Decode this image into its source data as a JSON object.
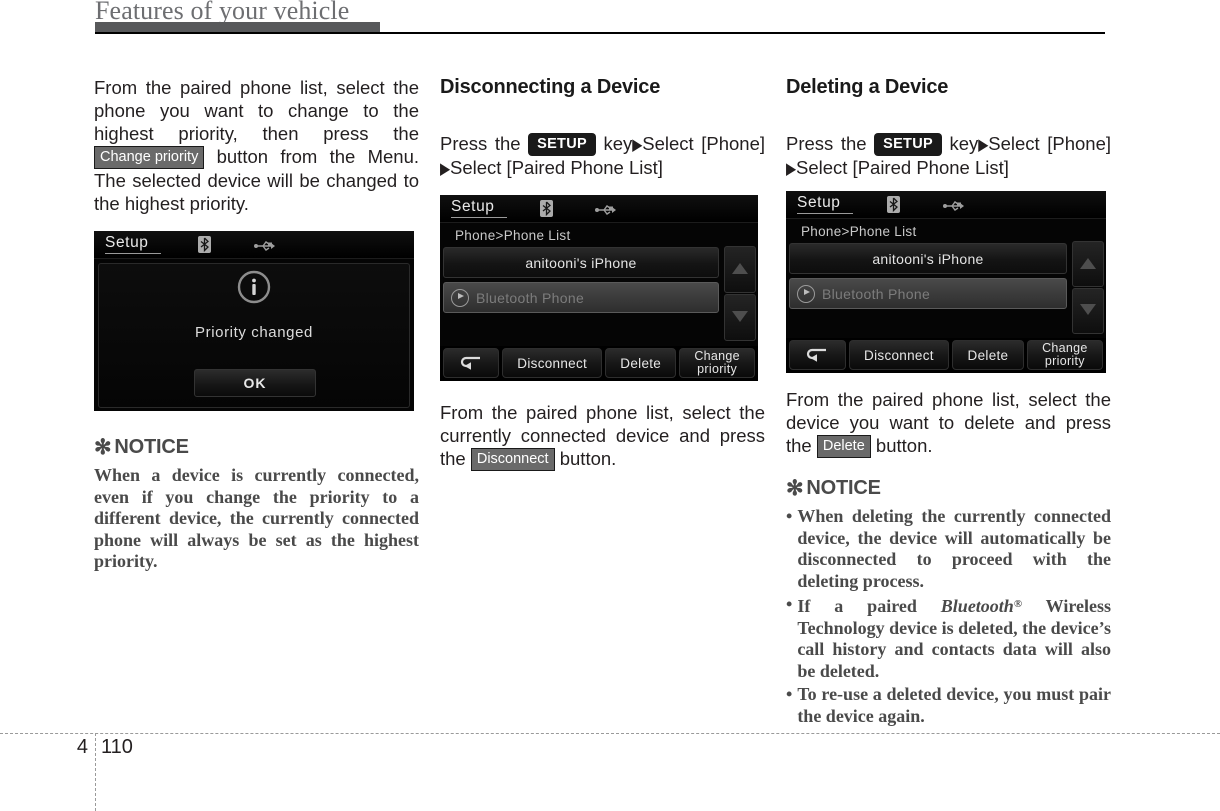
{
  "header": {
    "title": "Features of your vehicle"
  },
  "footer": {
    "chapter": "4",
    "page": "110"
  },
  "columns": {
    "col1": {
      "intro": {
        "part1": "From the paired phone list, select the phone you want to change to the highest priority, then press the",
        "badge": "Change priority",
        "part2": "button from the Menu. The selected device will be changed to the highest priority."
      },
      "screenshot": {
        "name": "setup-priority-changed-dialog",
        "title": "Setup",
        "bluetooth_icon": "bluetooth-icon",
        "usb_icon": "usb-icon",
        "info_icon": "info-icon",
        "message": "Priority changed",
        "ok_label": "OK"
      },
      "notice": {
        "star": "✻",
        "heading": "NOTICE",
        "body": "When a device is currently connected, even if you change the priority to a different device, the currently connected phone will always be set as the highest priority."
      }
    },
    "col2": {
      "heading": "Disconnecting a Device",
      "steps": {
        "press_the": "Press the",
        "setup_key": "SETUP",
        "key_word": "key",
        "arrow": "▶",
        "select1": "Select [Phone]",
        "select2": "Select [Paired Phone List]"
      },
      "screenshot": {
        "name": "setup-phone-list-screen",
        "title": "Setup",
        "bluetooth_icon": "bluetooth-icon",
        "usb_icon": "usb-icon",
        "breadcrumb": "Phone>Phone List",
        "rows": [
          {
            "label": "anitooni's iPhone",
            "has_play_icon": false,
            "selected": false
          },
          {
            "label": "Bluetooth Phone",
            "has_play_icon": true,
            "selected": true
          }
        ],
        "scroll_up_icon": "arrow-up-icon",
        "scroll_down_icon": "arrow-down-icon",
        "toolbar": [
          {
            "label": "",
            "icon": "back-arrow-icon"
          },
          {
            "label": "Disconnect",
            "icon": ""
          },
          {
            "label": "Delete",
            "icon": ""
          },
          {
            "label": "Change priority",
            "icon": ""
          }
        ]
      },
      "caption": {
        "part1": "From the paired phone list, select the currently connected device and press the",
        "badge": "Disconnect",
        "part2": "button."
      }
    },
    "col3": {
      "heading": "Deleting a Device",
      "steps": {
        "press_the": "Press the",
        "setup_key": "SETUP",
        "key_word": "key",
        "arrow": "▶",
        "select1": "Select [Phone]",
        "select2": "Select [Paired Phone List]"
      },
      "screenshot": {
        "name": "setup-phone-list-screen",
        "title": "Setup",
        "bluetooth_icon": "bluetooth-icon",
        "usb_icon": "usb-icon",
        "breadcrumb": "Phone>Phone List",
        "rows": [
          {
            "label": "anitooni's iPhone",
            "has_play_icon": false,
            "selected": false
          },
          {
            "label": "Bluetooth Phone",
            "has_play_icon": true,
            "selected": true
          }
        ],
        "scroll_up_icon": "arrow-up-icon",
        "scroll_down_icon": "arrow-down-icon",
        "toolbar": [
          {
            "label": "",
            "icon": "back-arrow-icon"
          },
          {
            "label": "Disconnect",
            "icon": ""
          },
          {
            "label": "Delete",
            "icon": ""
          },
          {
            "label": "Change priority",
            "icon": ""
          }
        ]
      },
      "caption": {
        "part1": "From the paired phone list, select the device you want to delete and press the",
        "badge": "Delete",
        "part2": "button."
      },
      "notice": {
        "star": "✻",
        "heading": "NOTICE",
        "items": [
          {
            "bullet": "•",
            "text": "When deleting the currently connected device, the device will automatically be disconnected to proceed with the deleting process."
          },
          {
            "bullet": "•",
            "text_pre": "If a paired ",
            "bluetooth": "Bluetooth",
            "reg": "®",
            "text_post": " Wireless Technology device is deleted, the device’s call history and contacts data will also be deleted."
          },
          {
            "bullet": "•",
            "text": "To re-use a deleted device, you must pair the device again."
          }
        ]
      }
    }
  },
  "device_labels": {
    "disconnect": "Disconnect",
    "delete": "Delete",
    "change_line1": "Change",
    "change_line2": "priority"
  },
  "colors": {
    "header_gray": "#58595b",
    "rule_black": "#000000",
    "badge_gray": "#6a6a6a",
    "badge_black": "#1a1a1a",
    "notice_gray": "#4a4a4a",
    "device_black": "#050505"
  }
}
